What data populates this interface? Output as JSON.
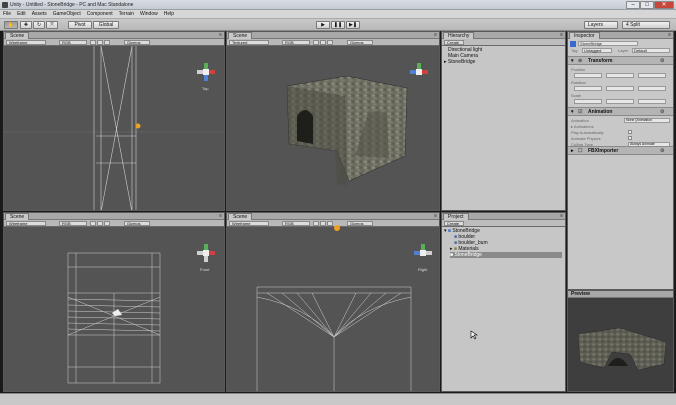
{
  "window": {
    "title": "Unity - Untitled - StoneBridge - PC and Mac Standalone"
  },
  "menu": [
    "File",
    "Edit",
    "Assets",
    "GameObject",
    "Component",
    "Terrain",
    "Window",
    "Help"
  ],
  "toolbar": {
    "pivot_label": "Pivot",
    "global_label": "Global",
    "layers_label": "Layers",
    "layout_label": "4 Split"
  },
  "scene_top_left": {
    "tab": "Scene",
    "render_mode": "Wireframe",
    "color_mode": "RGB",
    "gizmos": "Gizmos",
    "view_label": "Top"
  },
  "scene_top_right": {
    "tab": "Scene",
    "render_mode": "Textured",
    "color_mode": "RGB",
    "gizmos": "Gizmos"
  },
  "scene_bottom_left": {
    "tab": "Scene",
    "render_mode": "Wireframe",
    "color_mode": "RGB",
    "gizmos": "Gizmos",
    "view_label": "Front"
  },
  "scene_bottom_right": {
    "tab": "Scene",
    "render_mode": "Wireframe",
    "color_mode": "RGB",
    "gizmos": "Gizmos",
    "view_label": "Right"
  },
  "hierarchy": {
    "tab": "Hierarchy",
    "create": "Create",
    "items": [
      "Directional light",
      "Main Camera",
      "StoneBridge"
    ]
  },
  "project": {
    "tab": "Project",
    "create": "Create",
    "items": [
      "StoneBridge",
      "boulder",
      "boulder_bum",
      "Materials",
      "StoneBridge"
    ]
  },
  "inspector": {
    "tab": "Inspector",
    "object_name": "StoneBridge",
    "tag_label": "Tag",
    "tag_value": "Untagged",
    "layer_label": "Layer",
    "layer_value": "Default",
    "transform_title": "Transform",
    "position_label": "Position",
    "rotation_label": "Rotation",
    "scale_label": "Scale",
    "animation_title": "Animation",
    "animation_rows": [
      "Animation",
      "Animations",
      "Play Automatically",
      "Animate Physics",
      "Culling Type"
    ],
    "animation_value": "None (Animation",
    "culling_value": "Always Animate",
    "fbx_title": "FBXImporter"
  },
  "preview": {
    "label": "Preview"
  }
}
